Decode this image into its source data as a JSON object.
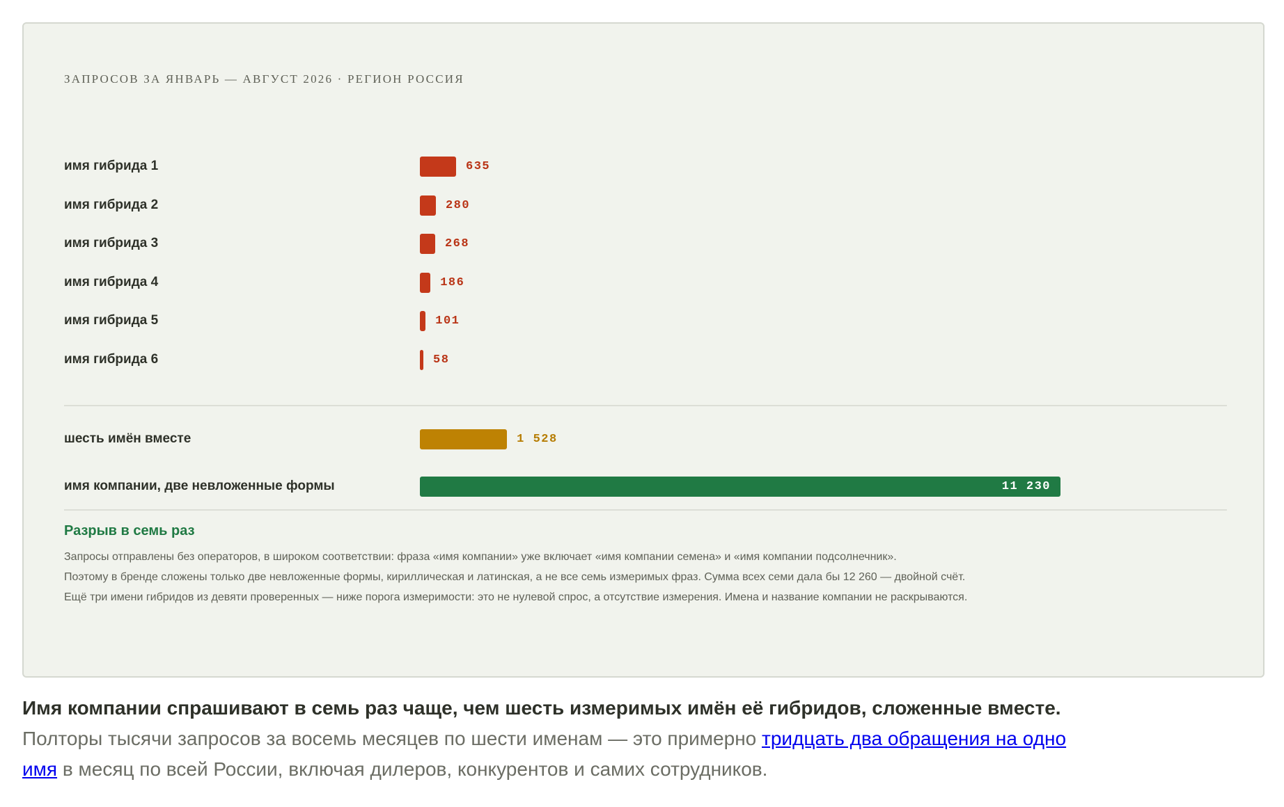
{
  "header": {
    "kicker": "ЗАПРОСОВ ЗА ЯНВАРЬ — АВГУСТ 2026 · РЕГИОН РОССИЯ"
  },
  "chart_data": {
    "type": "bar",
    "orientation": "horizontal",
    "subtitle": "ЗАПРОСОВ ЗА ЯНВАРЬ — АВГУСТ 2026 · РЕГИОН РОССИЯ",
    "categories": [
      "имя гибрида 1",
      "имя гибрида 2",
      "имя гибрида 3",
      "имя гибрида 4",
      "имя гибрида 5",
      "имя гибрида 6"
    ],
    "values": [
      635,
      280,
      268,
      186,
      101,
      58
    ],
    "value_labels": [
      "635",
      "280",
      "268",
      "186",
      "101",
      "58"
    ],
    "total": {
      "label": "шесть имён вместе",
      "value": 1528,
      "value_label": "1 528"
    },
    "brand": {
      "label": "имя компании, две невложенные формы",
      "value": 11230,
      "value_label": "11 230"
    },
    "xlim": [
      0,
      11230
    ],
    "grid": false,
    "colors": {
      "hybrids": "#c4391a",
      "total": "#be8203",
      "brand": "#207a44"
    }
  },
  "notes": {
    "title": "Разрыв в семь раз",
    "lines": [
      "Запросы отправлены без операторов, в широком соответствии: фраза «имя компании» уже включает «имя компании семена» и «имя компании подсолнечник».",
      "Поэтому в бренде сложены только две невложенные формы, кириллическая и латинская, а не все семь измеримых фраз. Сумма всех семи дала бы 12 260 — двойной счёт.",
      "Ещё три имени гибридов из девяти проверенных — ниже порога измеримости: это не нулевой спрос, а отсутствие измерения. Имена и название компании не раскрываются."
    ]
  },
  "caption": {
    "lead": "Имя компании спрашивают в семь раз чаще, чем шесть измеримых имён её гибридов, сложенные вместе.",
    "text_before_link": " Полторы тысячи запросов за восемь месяцев по шести именам — это примерно ",
    "link_text": "тридцать два обращения на одно имя",
    "text_after_link": " в месяц по всей России, включая дилеров, конкурентов и самих сотрудников."
  }
}
